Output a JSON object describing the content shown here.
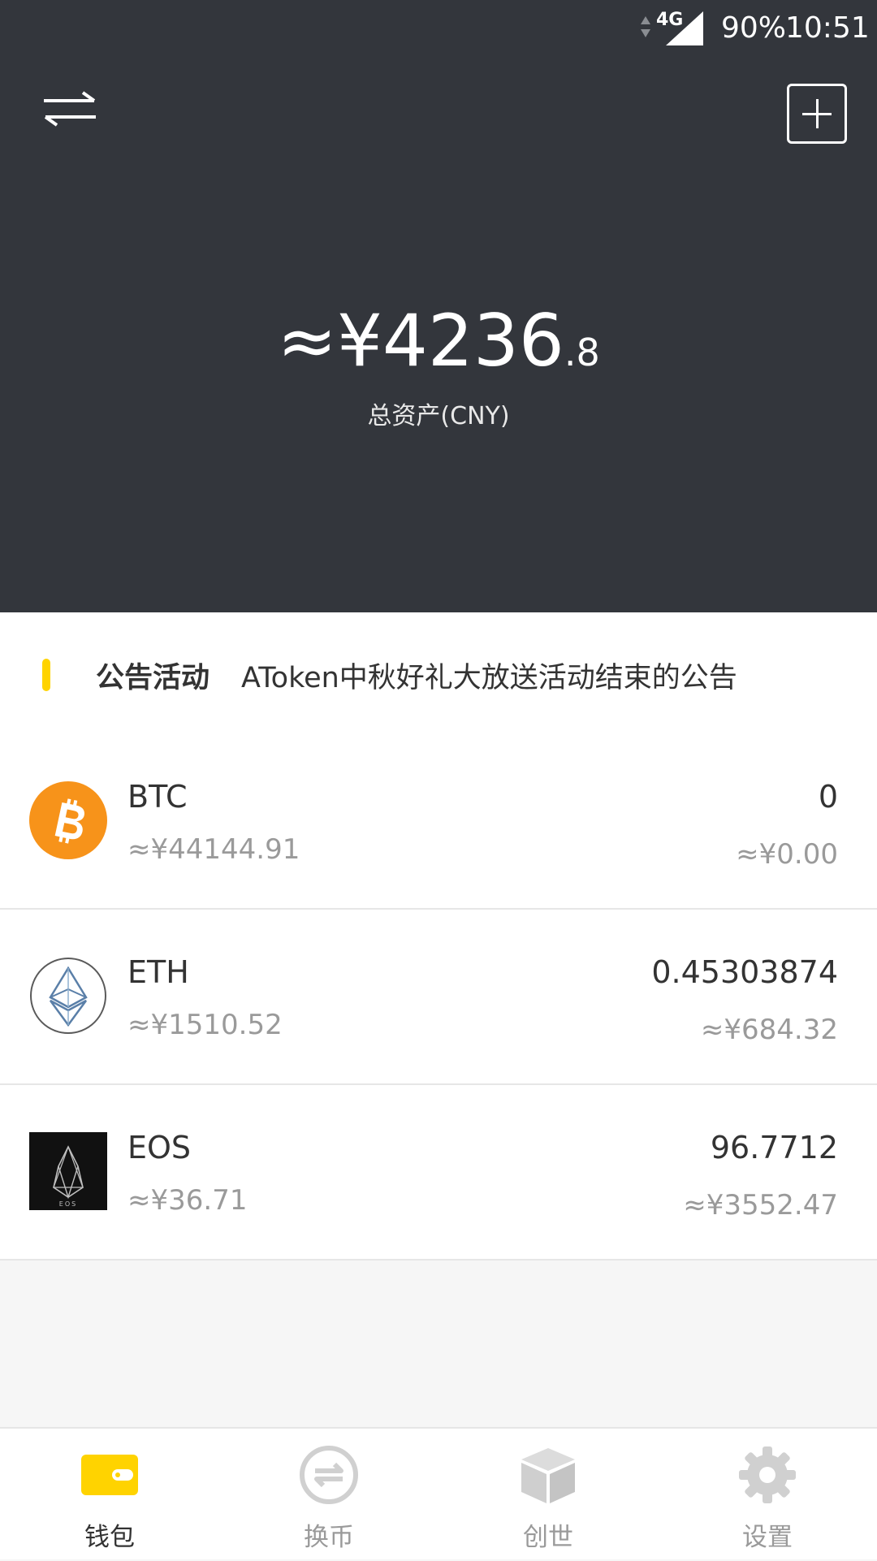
{
  "status_bar": {
    "network": "4G",
    "battery": "90%",
    "time": "10:51"
  },
  "header": {
    "total_amount": "≈¥4236",
    "total_decimal": ".8",
    "total_label": "总资产(CNY)"
  },
  "announcement": {
    "tag": "公告活动",
    "text": "AToken中秋好礼大放送活动结束的公告"
  },
  "tokens": [
    {
      "symbol": "BTC",
      "price": "≈¥44144.91",
      "balance": "0",
      "value": "≈¥0.00",
      "icon": "bitcoin-icon"
    },
    {
      "symbol": "ETH",
      "price": "≈¥1510.52",
      "balance": "0.45303874",
      "value": "≈¥684.32",
      "icon": "ethereum-icon"
    },
    {
      "symbol": "EOS",
      "price": "≈¥36.71",
      "balance": "96.7712",
      "value": "≈¥3552.47",
      "icon": "eos-icon",
      "icon_text": "EOS"
    }
  ],
  "nav": {
    "items": [
      {
        "label": "钱包",
        "icon": "wallet-icon",
        "active": true
      },
      {
        "label": "换币",
        "icon": "exchange-icon",
        "active": false
      },
      {
        "label": "创世",
        "icon": "cube-icon",
        "active": false
      },
      {
        "label": "设置",
        "icon": "gear-icon",
        "active": false
      }
    ]
  },
  "colors": {
    "header_bg": "#33363c",
    "accent": "#ffd300",
    "btc_orange": "#f7931a",
    "text_primary": "#333333",
    "text_secondary": "#9a9a9a"
  }
}
